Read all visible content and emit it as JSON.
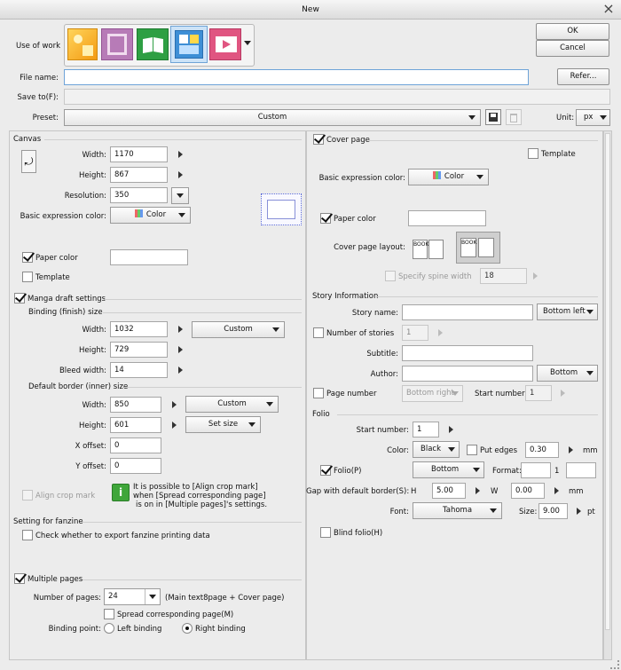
{
  "window": {
    "title": "New"
  },
  "top": {
    "use_of_work_label": "Use of work",
    "ok": "OK",
    "cancel": "Cancel",
    "file_name_label": "File name:",
    "file_name_value": "",
    "refer": "Refer...",
    "save_to_label": "Save to(F):",
    "save_to_value": "",
    "preset_label": "Preset:",
    "preset_value": "Custom",
    "unit_label": "Unit:",
    "unit_value": "px",
    "work_types": [
      {
        "name": "Illustration",
        "color": "#f3a51c"
      },
      {
        "name": "Webtoon",
        "color": "#b36fb3"
      },
      {
        "name": "Comic",
        "color": "#2f9b3e"
      },
      {
        "name": "Show all comic settings",
        "color": "#3e8fd6"
      },
      {
        "name": "Animation",
        "color": "#e05581"
      }
    ]
  },
  "canvas": {
    "title": "Canvas",
    "width_label": "Width:",
    "width": "1170",
    "height_label": "Height:",
    "height": "867",
    "resolution_label": "Resolution:",
    "resolution": "350",
    "basic_color_label": "Basic expression color:",
    "basic_color": "Color",
    "paper_color": "Paper color",
    "template": "Template"
  },
  "manga": {
    "title": "Manga draft settings",
    "binding_title": "Binding (finish) size",
    "width_label": "Width:",
    "width": "1032",
    "height_label": "Height:",
    "height": "729",
    "bleed_label": "Bleed width:",
    "bleed": "14",
    "binding_preset": "Custom",
    "border_title": "Default border (inner) size",
    "bwidth": "850",
    "bheight": "601",
    "border_preset": "Custom",
    "set_size": "Set size",
    "xoffset_label": "X offset:",
    "xoffset": "0",
    "yoffset_label": "Y offset:",
    "yoffset": "0",
    "align_crop": "Align crop mark",
    "info_lines": [
      "It is possible to [Align crop mark]",
      "when [Spread corresponding page]",
      "is on in [Multiple pages]'s settings."
    ]
  },
  "fanzine": {
    "title": "Setting for fanzine",
    "check": "Check whether to export fanzine printing data"
  },
  "pages": {
    "title": "Multiple pages",
    "count_label": "Number of pages:",
    "count": "24",
    "count_note": "(Main text8page + Cover page)",
    "spread": "Spread corresponding page(M)",
    "binding_label": "Binding point:",
    "left": "Left binding",
    "right": "Right binding"
  },
  "cover": {
    "title": "Cover page",
    "template": "Template",
    "basic_color_label": "Basic expression color:",
    "basic_color": "Color",
    "paper_color": "Paper color",
    "layout_label": "Cover page layout:",
    "book": "BOOK",
    "spine": "Specify spine width",
    "spine_value": "18"
  },
  "story": {
    "title": "Story Information",
    "name_label": "Story name:",
    "name_pos": "Bottom left",
    "num_label": "Number of stories",
    "num_value": "1",
    "subtitle_label": "Subtitle:",
    "author_label": "Author:",
    "author_pos": "Bottom",
    "page_num_label": "Page number",
    "page_pos": "Bottom right",
    "start_label": "Start number:",
    "start_value": "1"
  },
  "folio": {
    "title": "Folio",
    "start_label": "Start number:",
    "start_value": "1",
    "color_label": "Color:",
    "color_value": "Black",
    "put_edges": "Put edges",
    "edge_value": "0.30",
    "mm": "mm",
    "folio_p": "Folio(P)",
    "folio_pos": "Bottom",
    "format_label": "Format:",
    "format_mid": "1",
    "gap_label": "Gap with default border(S):",
    "h_label": "H",
    "h_value": "5.00",
    "w_label": "W",
    "w_value": "0.00",
    "font_label": "Font:",
    "font_value": "Tahoma",
    "size_label": "Size:",
    "size_value": "9.00",
    "pt": "pt",
    "blind": "Blind folio(H)"
  }
}
